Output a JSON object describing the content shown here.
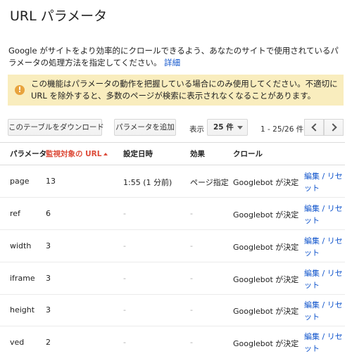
{
  "header": {
    "title": "URL パラメータ"
  },
  "intro": {
    "text": "Google がサイトをより効率的にクロールできるよう、あなたのサイトで使用されているパラメータの処理方法を指定してください。",
    "link": "詳細"
  },
  "alert": {
    "icon": "warning-icon",
    "text": "この機能はパラメータの動作を把握している場合にのみ使用してください。不適切に URL を除外すると、多数のページが検索に表示されなくなることがあります。"
  },
  "toolbar": {
    "download_label": "このテーブルをダウンロード",
    "add_label": "パラメータを追加",
    "show_label": "表示",
    "page_size": "25 件",
    "range": "1 - 25/26 件"
  },
  "table": {
    "columns": [
      "パラメータ",
      "監視対象の URL",
      "設定日時",
      "効果",
      "クロール"
    ],
    "rows": [
      {
        "param": "page",
        "urls": "13",
        "date": "1:55 (1 分前)",
        "effect": "ページ指定",
        "crawl": "Googlebot が決定",
        "action": "編集 / リセット"
      },
      {
        "param": "ref",
        "urls": "6",
        "date": "-",
        "effect": "-",
        "crawl": "Googlebot が決定",
        "action": "編集 / リセット"
      },
      {
        "param": "width",
        "urls": "3",
        "date": "-",
        "effect": "-",
        "crawl": "Googlebot が決定",
        "action": "編集 / リセット"
      },
      {
        "param": "iframe",
        "urls": "3",
        "date": "-",
        "effect": "-",
        "crawl": "Googlebot が決定",
        "action": "編集 / リセット"
      },
      {
        "param": "height",
        "urls": "3",
        "date": "-",
        "effect": "-",
        "crawl": "Googlebot が決定",
        "action": "編集 / リセット"
      },
      {
        "param": "ved",
        "urls": "2",
        "date": "-",
        "effect": "-",
        "crawl": "Googlebot が決定",
        "action": "編集 / リセット"
      }
    ]
  },
  "colors": {
    "link": "#1155cc",
    "sorted_header": "#dd4b39",
    "alert_bg": "#f9edbe"
  }
}
